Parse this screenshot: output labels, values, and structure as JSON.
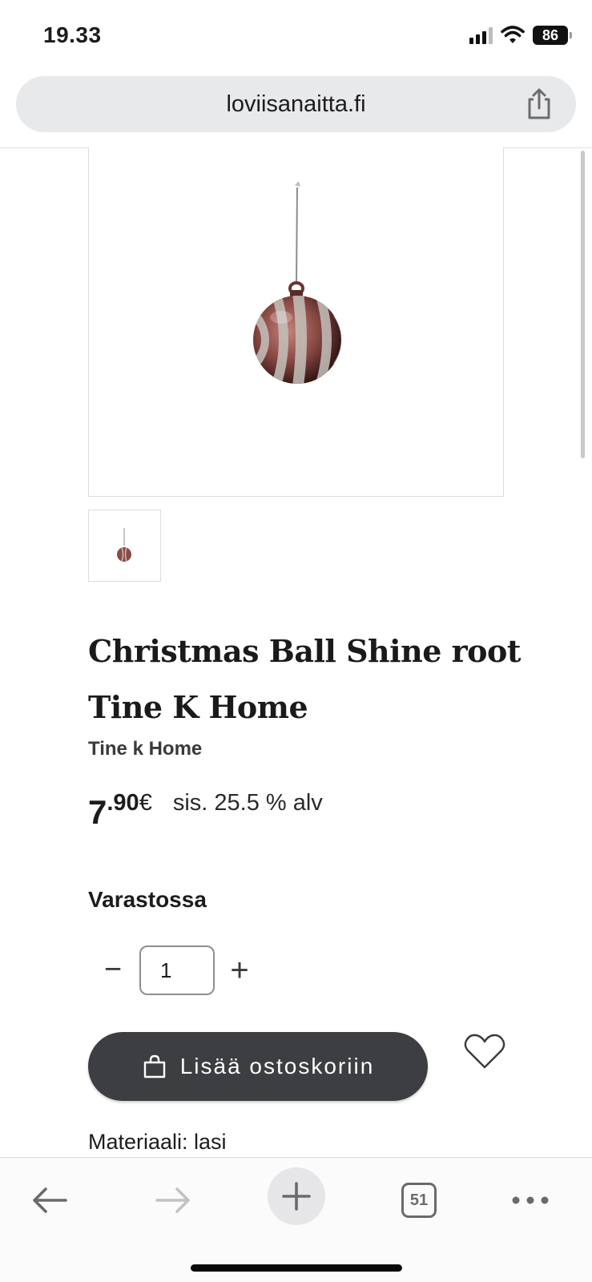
{
  "status_bar": {
    "time": "19.33",
    "battery": "86",
    "icons": [
      "cellular-signal-icon",
      "wifi-icon",
      "battery-icon"
    ]
  },
  "browser": {
    "url": "loviisanaitta.fi",
    "share_icon": "share-icon",
    "open_tabs_count": "51",
    "toolbar_icons": [
      "back-arrow-icon",
      "forward-arrow-icon",
      "plus-icon",
      "tabs-icon",
      "more-icon"
    ]
  },
  "product": {
    "title": "Christmas Ball Shine root Tine K Home",
    "brand": "Tine k Home",
    "price_integer": "7",
    "price_decimal": ".90",
    "price_currency": "€",
    "vat_text": "sis. 25.5 % alv",
    "stock_status": "Varastossa",
    "quantity": "1",
    "quantity_minus_symbol": "−",
    "quantity_plus_symbol": "+",
    "add_to_cart_label": "Lisää ostoskoriin",
    "material": "Materiaali: lasi"
  },
  "colors": {
    "button_background": "#3d3e42",
    "url_bar_background": "#e8e9eb",
    "ornament_color": "#8a4a44"
  }
}
